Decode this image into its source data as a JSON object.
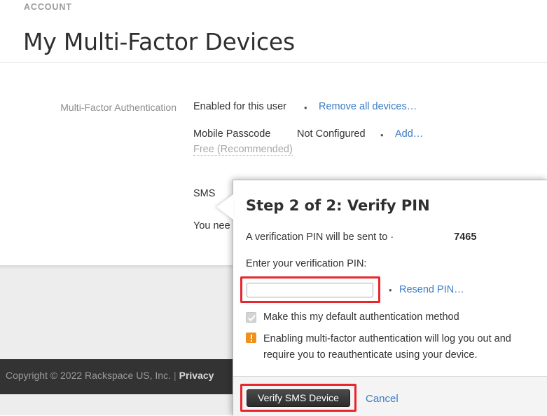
{
  "header": {
    "eyebrow": "ACCOUNT",
    "title": "My Multi-Factor Devices"
  },
  "main": {
    "mfa_label": "Multi-Factor Authentication",
    "mfa_status": "Enabled for this user",
    "remove_all_link": "Remove all devices…",
    "mobile_passcode_name": "Mobile Passcode",
    "mobile_passcode_status": "Not Configured",
    "mobile_passcode_add_link": "Add…",
    "mobile_passcode_note": "Free (Recommended)",
    "sms_name": "SMS",
    "sms_help_text": "You nee",
    "bullet": "•"
  },
  "modal": {
    "title": "Step 2 of 2: Verify PIN",
    "sent_to_prefix": "A verification PIN will be sent to ·",
    "sent_to_masked": "",
    "sent_to_last4": "7465",
    "enter_pin_label": "Enter your verification PIN:",
    "pin_value": "",
    "pin_placeholder": "",
    "bullet": "•",
    "resend_link": "Resend PIN…",
    "default_method_label": "Make this my default authentication method",
    "default_method_checked": true,
    "warning_text": "Enabling multi-factor authentication will log you out and require you to reauthenticate using your device.",
    "verify_button": "Verify SMS Device",
    "cancel_link": "Cancel"
  },
  "footer": {
    "copyright": "Copyright © 2022 Rackspace US, Inc.",
    "pipe": "|",
    "privacy_link": "Privacy"
  },
  "colors": {
    "link": "#3b7cc4",
    "highlight": "#e8262d",
    "warning": "#f0911d",
    "footer_bg": "#333333"
  }
}
